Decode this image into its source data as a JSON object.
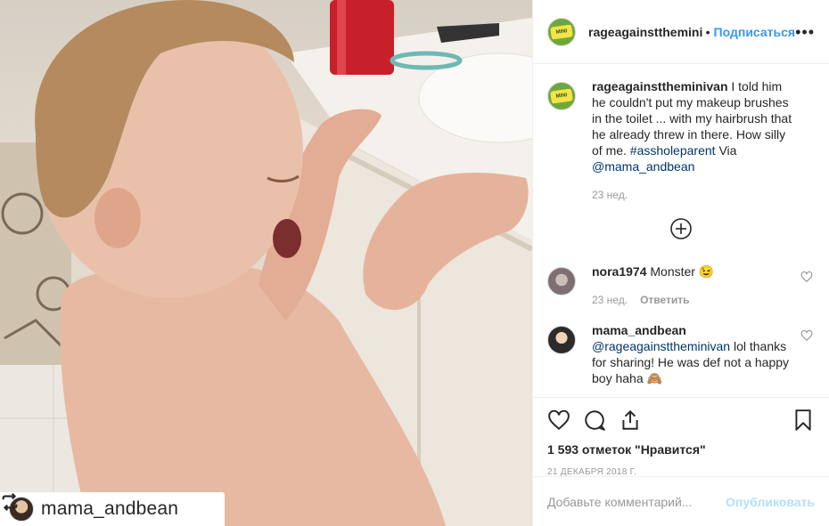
{
  "photo": {
    "alt": "",
    "repost_user": "mama_andbean"
  },
  "header": {
    "username": "rageagainsttheminivan",
    "separator": "•",
    "follow_label": "Подписаться",
    "more_label": "•••"
  },
  "caption": {
    "username": "rageagainsttheminivan",
    "text": "I told him he couldn't put my makeup brushes in the toilet ... with my hairbrush that he already threw in there. How silly of me.",
    "hashtag": "#assholeparent",
    "via": "Via",
    "mention": "@mama_andbean",
    "time": "23 нед."
  },
  "comments": [
    {
      "username": "nora1974",
      "text": "Monster 😉",
      "time": "23 нед.",
      "reply_label": "Ответить"
    },
    {
      "username": "mama_andbean",
      "mention": "@rageagainsttheminivan",
      "text": "lol thanks for sharing! He was def not a happy boy haha 🙈"
    }
  ],
  "actions": {
    "likes_text": "1 593 отметок \"Нравится\"",
    "date": "21 ДЕКАБРЯ 2018 Г."
  },
  "add_comment": {
    "placeholder": "Добавьте комментарий...",
    "publish_label": "Опубликовать"
  },
  "colors": {
    "link": "#003569",
    "follow": "#3897f0",
    "muted": "#999999",
    "publish_disabled": "#b2dffc"
  }
}
